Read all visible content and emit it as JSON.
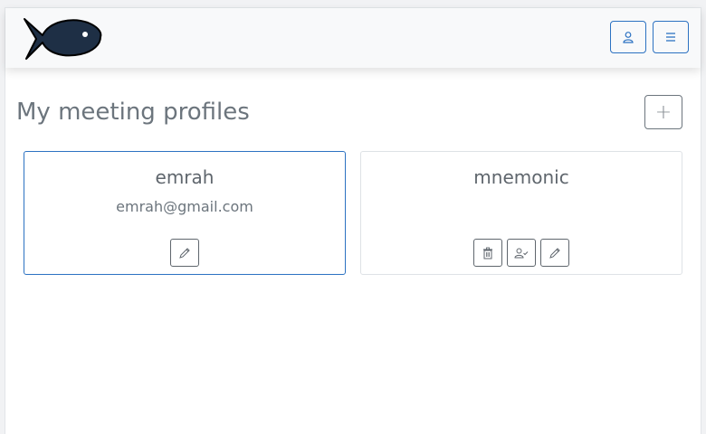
{
  "navbar": {
    "logo_icon": "fish-logo-icon",
    "user_button_icon": "user-icon",
    "menu_button_icon": "hamburger-menu-icon"
  },
  "main": {
    "title": "My meeting profiles",
    "add_button_label": "+"
  },
  "profiles": [
    {
      "name": "emrah",
      "email": "emrah@gmail.com",
      "selected": true,
      "actions": [
        "edit-icon"
      ]
    },
    {
      "name": "mnemonic",
      "email": "",
      "selected": false,
      "actions": [
        "trash-icon",
        "user-check-icon",
        "edit-icon"
      ]
    }
  ],
  "colors": {
    "accent": "#2c72c2",
    "text": "#6c757d",
    "logo_fill": "#1e2f45"
  }
}
